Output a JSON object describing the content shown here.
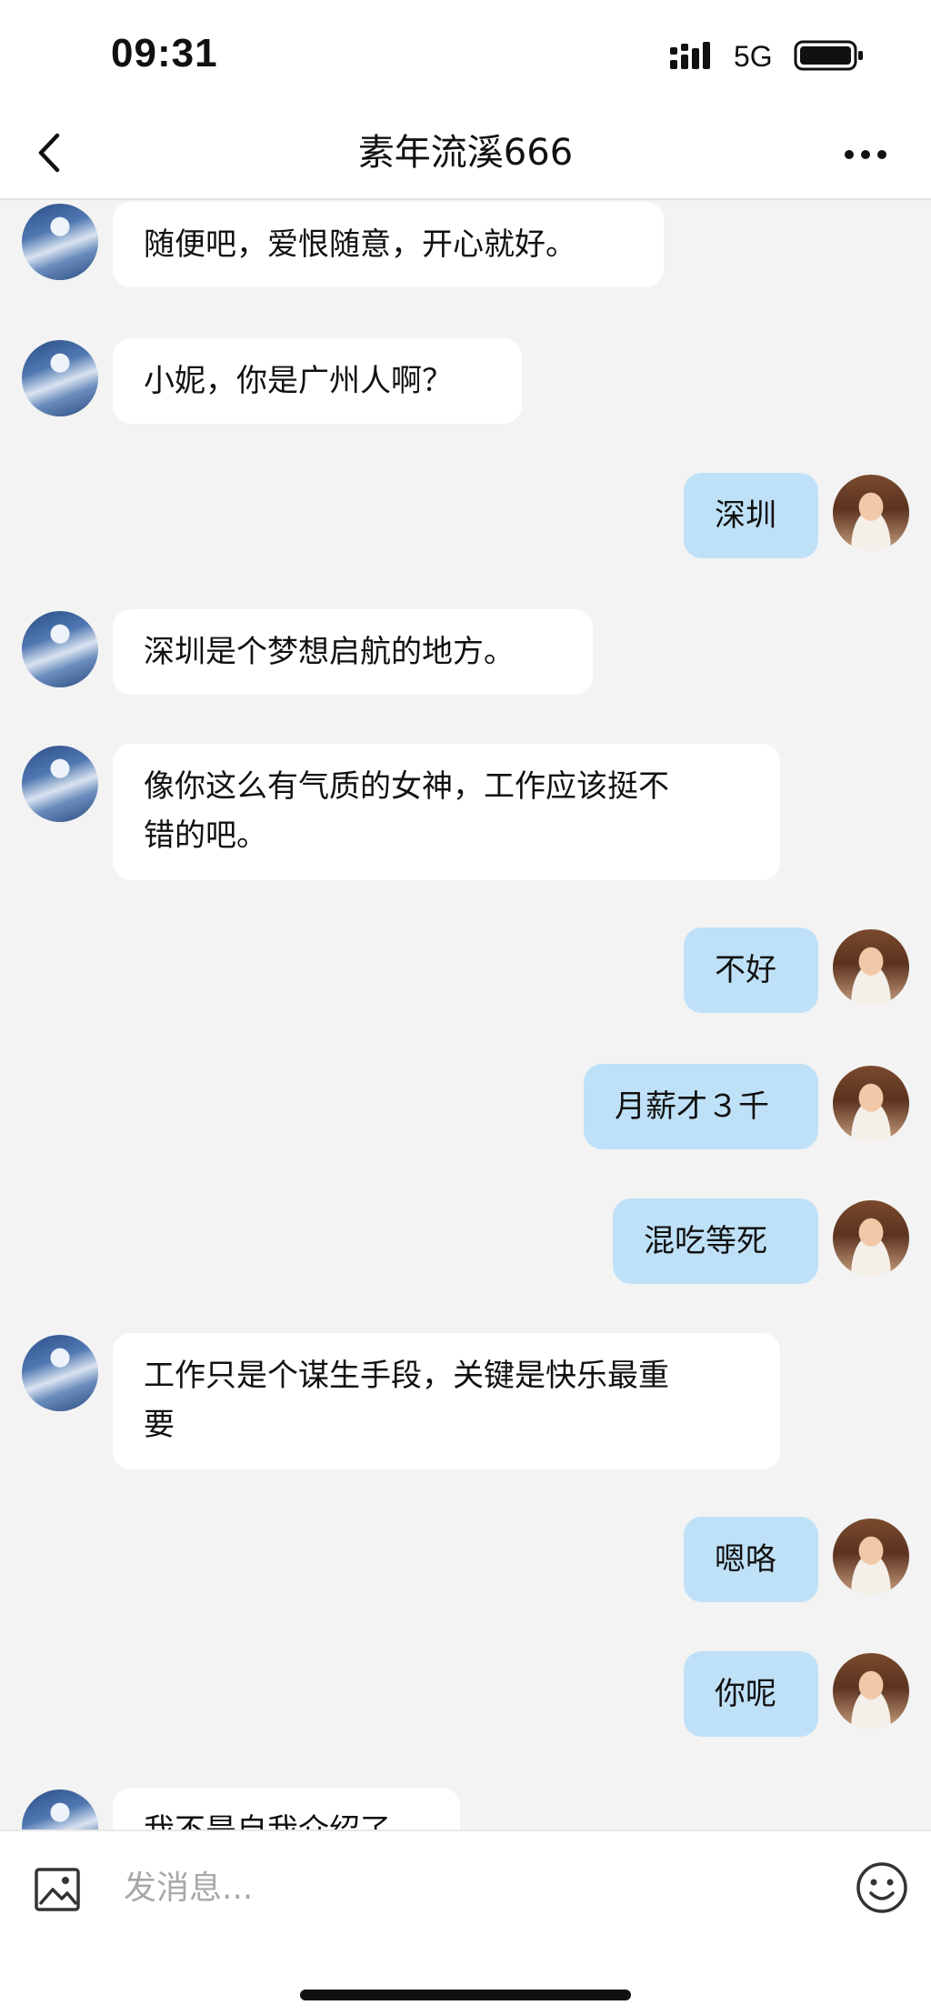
{
  "status_bar": {
    "time": "09:31",
    "network": "5G",
    "icons": [
      "signal-icon",
      "battery-icon"
    ]
  },
  "nav": {
    "title": "素年流溪666",
    "back_icon": "chevron-left-icon",
    "more_icon": "more-horizontal-icon"
  },
  "messages": [
    {
      "from": "other",
      "text": "随便吧，爱恨随意，开心就好。"
    },
    {
      "from": "other",
      "text": "小妮，你是广州人啊？"
    },
    {
      "from": "me",
      "text": "深圳"
    },
    {
      "from": "other",
      "text": "深圳是个梦想启航的地方。"
    },
    {
      "from": "other",
      "text": "像你这么有气质的女神，工作应该挺不\n错的吧。"
    },
    {
      "from": "me",
      "text": "不好"
    },
    {
      "from": "me",
      "text": "月薪才３千"
    },
    {
      "from": "me",
      "text": "混吃等死"
    },
    {
      "from": "other",
      "text": "工作只是个谋生手段，关键是快乐最重\n要"
    },
    {
      "from": "me",
      "text": "嗯咯"
    },
    {
      "from": "me",
      "text": "你呢"
    },
    {
      "from": "other",
      "text": "我不是自我介绍了"
    }
  ],
  "input_bar": {
    "placeholder": "发消息...",
    "image_icon": "image-icon",
    "emoji_icon": "emoji-smile-icon"
  },
  "colors": {
    "background": "#f3f3f3",
    "my_bubble": "#bfe1f8",
    "other_bubble": "#ffffff"
  }
}
